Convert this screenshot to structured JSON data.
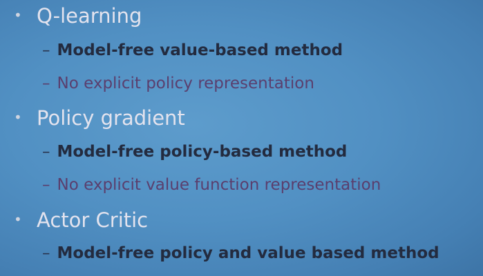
{
  "slide": {
    "sections": [
      {
        "title": "Q-learning",
        "points": [
          {
            "text": "Model-free value-based method",
            "bold": true
          },
          {
            "text": "No explicit policy representation",
            "bold": false
          }
        ]
      },
      {
        "title": "Policy gradient",
        "points": [
          {
            "text": "Model-free policy-based method",
            "bold": true
          },
          {
            "text": "No explicit value function representation",
            "bold": false
          }
        ]
      },
      {
        "title": "Actor Critic",
        "points": [
          {
            "text": "Model-free policy and value based method",
            "bold": true
          }
        ]
      }
    ],
    "bullet_glyph": "•",
    "dash_glyph": "–",
    "colors": {
      "background": "#5190c3",
      "heading_text": "#e3e3ee",
      "bold_text": "#232b3f",
      "plain_text": "#5a3f6e"
    }
  }
}
